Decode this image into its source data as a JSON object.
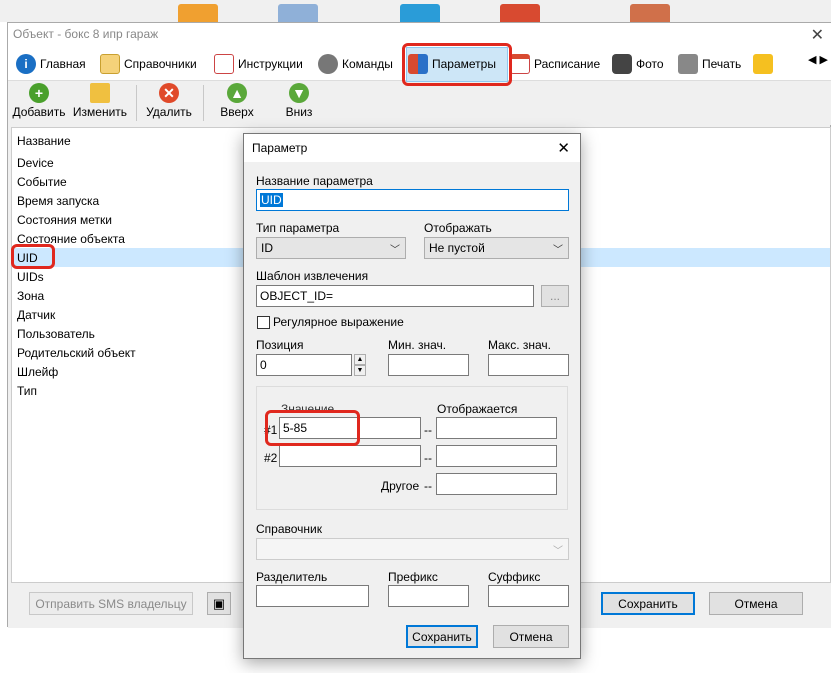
{
  "window": {
    "title": "Объект - бокс 8 ипр гараж",
    "tabs": [
      {
        "label": "Главная",
        "icon": "info-icon"
      },
      {
        "label": "Справочники",
        "icon": "book-icon"
      },
      {
        "label": "Инструкции",
        "icon": "document-icon"
      },
      {
        "label": "Команды",
        "icon": "gear-icon"
      },
      {
        "label": "Параметры",
        "icon": "grid-icon",
        "selected": true
      },
      {
        "label": "Расписание",
        "icon": "calendar-icon"
      },
      {
        "label": "Фото",
        "icon": "camera-icon"
      },
      {
        "label": "Печать",
        "icon": "printer-icon"
      }
    ],
    "toolbar": {
      "add": "Добавить",
      "edit": "Изменить",
      "delete": "Удалить",
      "up": "Вверх",
      "down": "Вниз"
    },
    "list": {
      "header": "Название",
      "items": [
        "Device",
        "Событие",
        "Время запуска",
        "Состояния метки",
        "Состояние объекта",
        "UID",
        "UIDs",
        "Зона",
        "Датчик",
        "Пользователь",
        "Родительский объект",
        "Шлейф",
        "Тип"
      ],
      "selected_index": 5
    },
    "bottom": {
      "send_sms": "Отправить SMS владельцу",
      "save": "Сохранить",
      "cancel": "Отмена"
    }
  },
  "dialog": {
    "title": "Параметр",
    "name_label": "Название параметра",
    "name_value": "UID",
    "type_label": "Тип параметра",
    "type_value": "ID",
    "display_label": "Отображать",
    "display_value": "Не пустой",
    "template_label": "Шаблон извлечения",
    "template_value": "OBJECT_ID=",
    "browse_label": "...",
    "regex_label": "Регулярное выражение",
    "position_label": "Позиция",
    "position_value": "0",
    "min_label": "Мин. знач.",
    "max_label": "Макс. знач.",
    "value_label": "Значение",
    "shown_label": "Отображается",
    "row1_label": "#1",
    "row1_value": "5-85",
    "row2_label": "#2",
    "dash": "--",
    "other_label": "Другое",
    "dictionary_label": "Справочник",
    "separator_label": "Разделитель",
    "prefix_label": "Префикс",
    "suffix_label": "Суффикс",
    "save": "Сохранить",
    "cancel": "Отмена"
  },
  "colors": {
    "highlight_red": "#e0281e",
    "selection_blue": "#cce8ff",
    "accent": "#0078d7"
  }
}
